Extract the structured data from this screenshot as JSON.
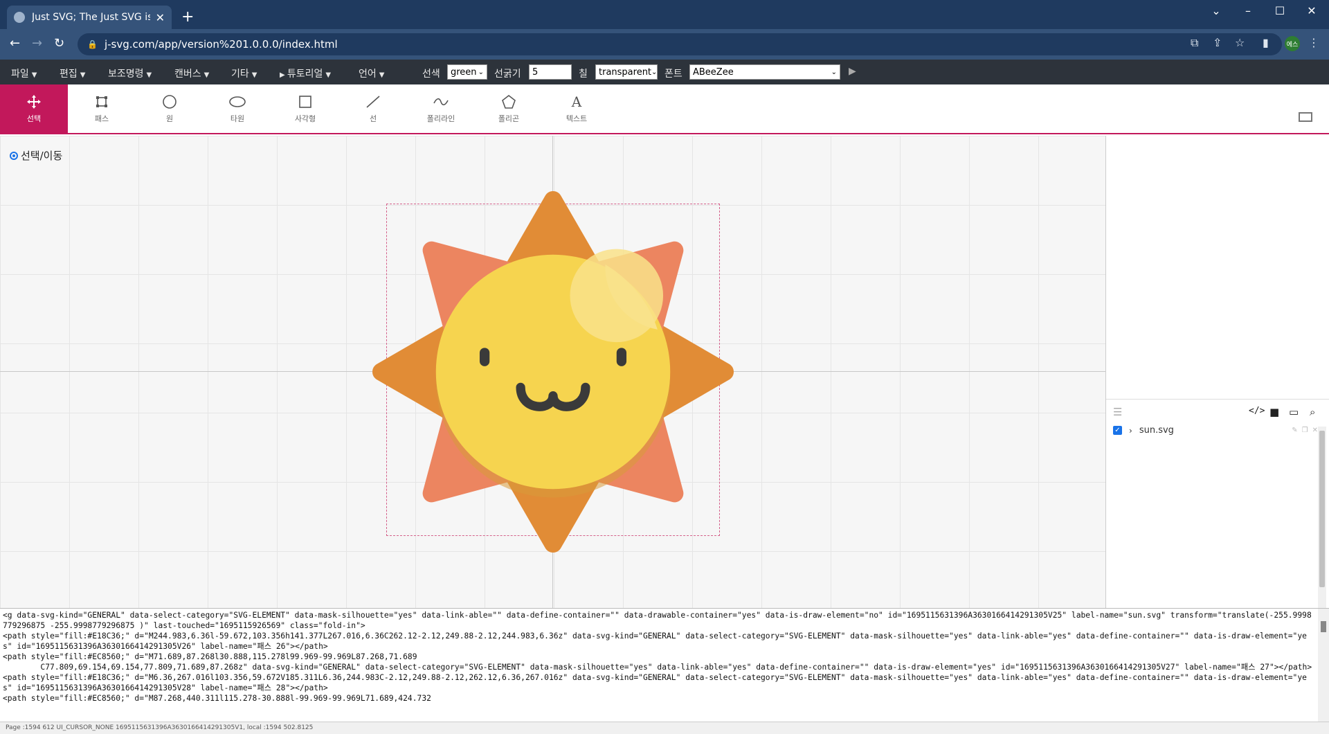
{
  "browser": {
    "tab_title": "Just SVG; The Just SVG is simple",
    "url": "j-svg.com/app/version%201.0.0.0/index.html",
    "profile_label": "에스"
  },
  "menu": {
    "items": [
      "파일",
      "편집",
      "보조명령",
      "캔버스",
      "기타",
      "튜토리얼",
      "언어"
    ],
    "stroke_color_label": "선색",
    "stroke_color_value": "green",
    "stroke_width_label": "선굵기",
    "stroke_width_value": "5",
    "fill_label": "칠",
    "fill_value": "transparent",
    "font_label": "폰트",
    "font_value": "ABeeZee"
  },
  "tools": [
    {
      "label": "선택",
      "icon": "move-icon"
    },
    {
      "label": "패스",
      "icon": "path-icon"
    },
    {
      "label": "원",
      "icon": "circle-icon"
    },
    {
      "label": "타원",
      "icon": "ellipse-icon"
    },
    {
      "label": "사각형",
      "icon": "rectangle-icon"
    },
    {
      "label": "선",
      "icon": "line-icon"
    },
    {
      "label": "폴리라인",
      "icon": "polyline-icon"
    },
    {
      "label": "폴리곤",
      "icon": "polygon-icon"
    },
    {
      "label": "텍스트",
      "icon": "text-icon"
    }
  ],
  "canvas": {
    "mode_label": "선택/이동"
  },
  "layers": {
    "file_name": "sun.svg"
  },
  "colors": {
    "accent": "#c2185b",
    "sun_body": "#F6D44F",
    "ray_orange": "#E18C36",
    "ray_salmon": "#EC8560"
  },
  "code_text": "<g data-svg-kind=\"GENERAL\" data-select-category=\"SVG-ELEMENT\" data-mask-silhouette=\"yes\" data-link-able=\"\" data-define-container=\"\" data-drawable-container=\"yes\" data-is-draw-element=\"no\" id=\"1695115631396A3630166414291305V25\" label-name=\"sun.svg\" transform=\"translate(-255.9998779296875 -255.9998779296875 )\" last-touched=\"1695115926569\" class=\"fold-in\">\n<path style=\"fill:#E18C36;\" d=\"M244.983,6.36l-59.672,103.356h141.377L267.016,6.36C262.12-2.12,249.88-2.12,244.983,6.36z\" data-svg-kind=\"GENERAL\" data-select-category=\"SVG-ELEMENT\" data-mask-silhouette=\"yes\" data-link-able=\"yes\" data-define-container=\"\" data-is-draw-element=\"yes\" id=\"1695115631396A3630166414291305V26\" label-name=\"패스 26\"></path>\n<path style=\"fill:#EC8560;\" d=\"M71.689,87.268l30.888,115.278l99.969-99.969L87.268,71.689\n        C77.809,69.154,69.154,77.809,71.689,87.268z\" data-svg-kind=\"GENERAL\" data-select-category=\"SVG-ELEMENT\" data-mask-silhouette=\"yes\" data-link-able=\"yes\" data-define-container=\"\" data-is-draw-element=\"yes\" id=\"1695115631396A3630166414291305V27\" label-name=\"패스 27\"></path>\n<path style=\"fill:#E18C36;\" d=\"M6.36,267.016l103.356,59.672V185.311L6.36,244.983C-2.12,249.88-2.12,262.12,6.36,267.016z\" data-svg-kind=\"GENERAL\" data-select-category=\"SVG-ELEMENT\" data-mask-silhouette=\"yes\" data-link-able=\"yes\" data-define-container=\"\" data-is-draw-element=\"yes\" id=\"1695115631396A3630166414291305V28\" label-name=\"패스 28\"></path>\n<path style=\"fill:#EC8560;\" d=\"M87.268,440.311l115.278-30.888l-99.969-99.969L71.689,424.732",
  "status_text": "Page :1594 612 UI_CURSOR_NONE 1695115631396A3630166414291305V1, local :1594 502.8125"
}
